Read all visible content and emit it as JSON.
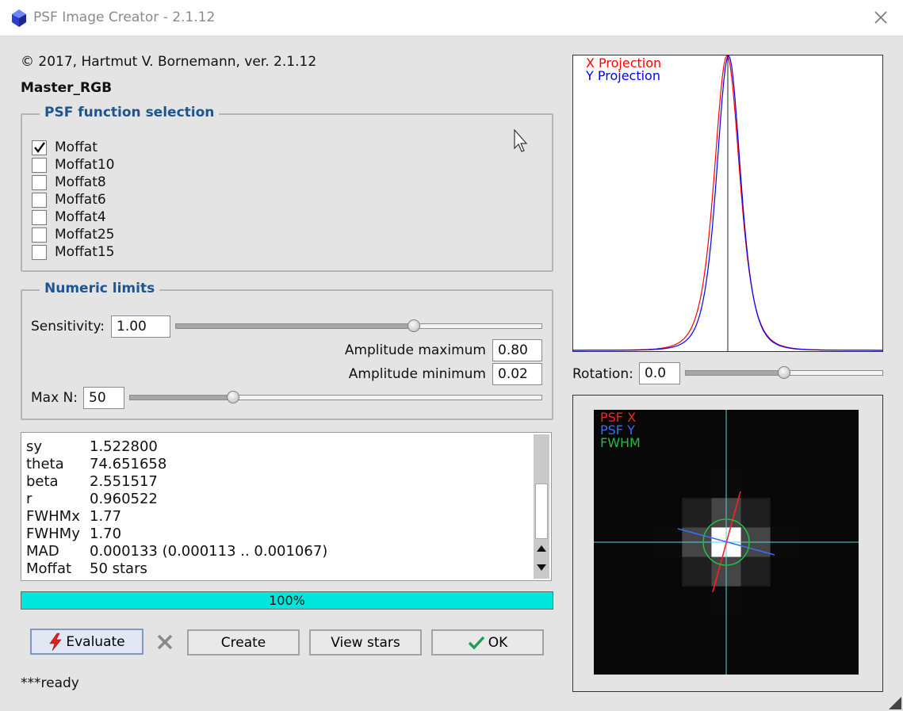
{
  "window": {
    "title": "PSF Image Creator - 2.1.12"
  },
  "header": {
    "copyright": "© 2017, Hartmut V. Bornemann, ver. 2.1.12",
    "image_name": "Master_RGB"
  },
  "psf_selection": {
    "title": "PSF function selection",
    "items": [
      {
        "label": "Moffat",
        "checked": true
      },
      {
        "label": "Moffat10",
        "checked": false
      },
      {
        "label": "Moffat8",
        "checked": false
      },
      {
        "label": "Moffat6",
        "checked": false
      },
      {
        "label": "Moffat4",
        "checked": false
      },
      {
        "label": "Moffat25",
        "checked": false
      },
      {
        "label": "Moffat15",
        "checked": false
      }
    ]
  },
  "numeric_limits": {
    "title": "Numeric limits",
    "sensitivity_label": "Sensitivity:",
    "sensitivity_value": "1.00",
    "sensitivity_slider": 0.65,
    "amp_max_label": "Amplitude maximum",
    "amp_max_value": "0.80",
    "amp_min_label": "Amplitude minimum",
    "amp_min_value": "0.02",
    "maxn_label": "Max N:",
    "maxn_value": "50",
    "maxn_slider": 0.25
  },
  "log": {
    "rows": [
      {
        "key": "sy",
        "value": "1.522800"
      },
      {
        "key": "theta",
        "value": "74.651658"
      },
      {
        "key": "beta",
        "value": "2.551517"
      },
      {
        "key": "r",
        "value": "0.960522"
      },
      {
        "key": "FWHMx",
        "value": "1.77"
      },
      {
        "key": "FWHMy",
        "value": "1.70"
      },
      {
        "key": "MAD",
        "value": "0.000133 (0.000113 .. 0.001067)"
      },
      {
        "key": "Moffat",
        "value": "50 stars"
      }
    ]
  },
  "progress": {
    "value": 1.0,
    "label": "100%"
  },
  "buttons": {
    "evaluate": "Evaluate",
    "create": "Create",
    "view_stars": "View stars",
    "ok": "OK"
  },
  "status": "***ready",
  "projection": {
    "x_label": "X Projection",
    "y_label": "Y Projection",
    "x_color": "#ff0000",
    "y_color": "#0000ff"
  },
  "rotation": {
    "label": "Rotation:",
    "value": "0.0",
    "slider": 0.5
  },
  "psf_view": {
    "psf_x_label": "PSF X",
    "psf_y_label": "PSF Y",
    "fwhm_label": "FWHM",
    "psf_x_color": "#ff2020",
    "psf_y_color": "#3a6cff",
    "fwhm_color": "#22bb44"
  },
  "icons": {
    "app": "psf-app-icon",
    "close": "close-icon",
    "evaluate": "lightning-icon",
    "cancel": "cancel-x-icon",
    "ok": "checkmark-icon"
  }
}
